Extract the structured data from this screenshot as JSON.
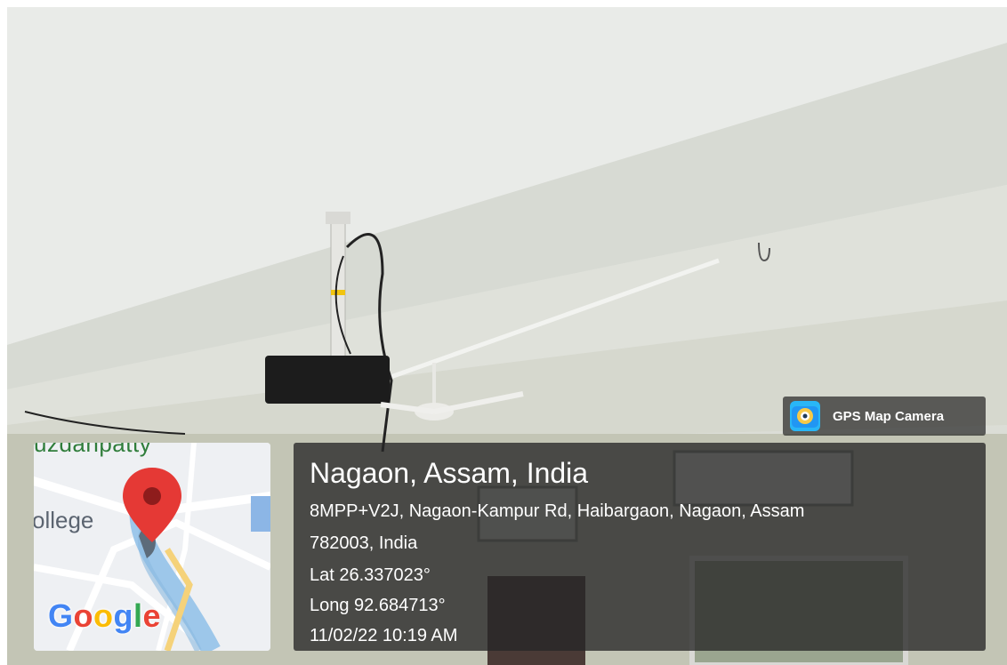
{
  "app_badge": {
    "name": "GPS Map Camera",
    "icon": "gps-map-camera-icon"
  },
  "map": {
    "label_top": "uzdanpatty",
    "label_college": "ollege",
    "logo": [
      "G",
      "o",
      "o",
      "g",
      "l",
      "e"
    ],
    "logo_colors": [
      "#4285f4",
      "#ea4335",
      "#fbbc05",
      "#4285f4",
      "#34a853",
      "#ea4335"
    ],
    "marker_color": "#e53935"
  },
  "location": {
    "title": "Nagaon, Assam, India",
    "address_line1": "8MPP+V2J, Nagaon-Kampur Rd, Haibargaon, Nagaon, Assam",
    "address_line2": "782003, India",
    "lat": "Lat 26.337023°",
    "long": "Long 92.684713°",
    "datetime": "11/02/22 10:19 AM"
  }
}
